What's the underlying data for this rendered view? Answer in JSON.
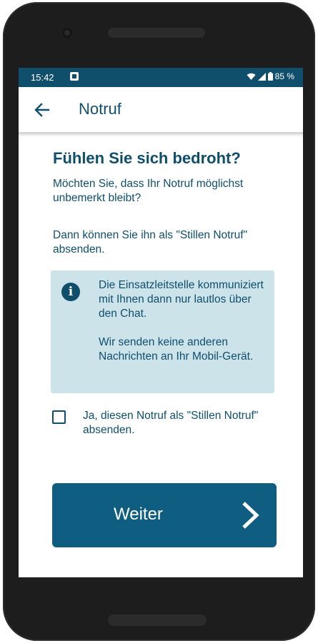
{
  "status": {
    "time": "15:42",
    "battery": "85 %"
  },
  "appbar": {
    "title": "Notruf"
  },
  "main": {
    "headline": "Fühlen Sie sich bedroht?",
    "paragraph1": "Möchten Sie, dass Ihr Notruf möglichst unbemerkt bleibt?",
    "paragraph2": "Dann können Sie ihn als \"Stillen Notruf\" absenden."
  },
  "info": {
    "icon": "i",
    "text1": "Die Einsatzleitstelle kommuniziert mit Ihnen dann nur lautlos über den Chat.",
    "text2": "Wir senden keine anderen Nachrichten an Ihr Mobil-Gerät."
  },
  "checkbox": {
    "label": "Ja, diesen Notruf als \"Stillen Notruf\" absenden.",
    "checked": false
  },
  "button": {
    "label": "Weiter"
  },
  "colors": {
    "primary": "#0f4f6c",
    "button": "#0f5d80",
    "info_bg": "#cde3ea"
  }
}
